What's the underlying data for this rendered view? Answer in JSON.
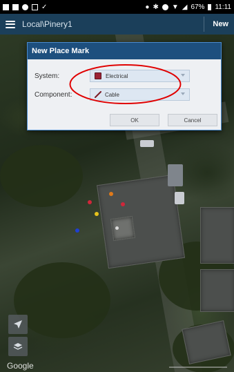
{
  "status_bar": {
    "battery": "67%",
    "time": "11:11"
  },
  "app_bar": {
    "title": "Local\\Pinery1",
    "new_label": "New"
  },
  "dialog": {
    "title": "New Place Mark",
    "system_label": "System:",
    "system_value": "Electrical",
    "component_label": "Component:",
    "component_value": "Cable",
    "ok_label": "OK",
    "cancel_label": "Cancel"
  },
  "map": {
    "attribution": "Google",
    "pins": [
      {
        "name": "pin-red-1",
        "color": "#d0263a"
      },
      {
        "name": "pin-orange",
        "color": "#e07a1a"
      },
      {
        "name": "pin-red-2",
        "color": "#d0263a"
      },
      {
        "name": "pin-yellow",
        "color": "#e6c21c"
      },
      {
        "name": "pin-blue",
        "color": "#1f3fd1"
      },
      {
        "name": "pin-white",
        "color": "#d8d8d8"
      }
    ]
  },
  "colors": {
    "app_bar": "#1b3f5a",
    "dialog_header": "#1d4f7e",
    "annotation": "#e00000"
  }
}
